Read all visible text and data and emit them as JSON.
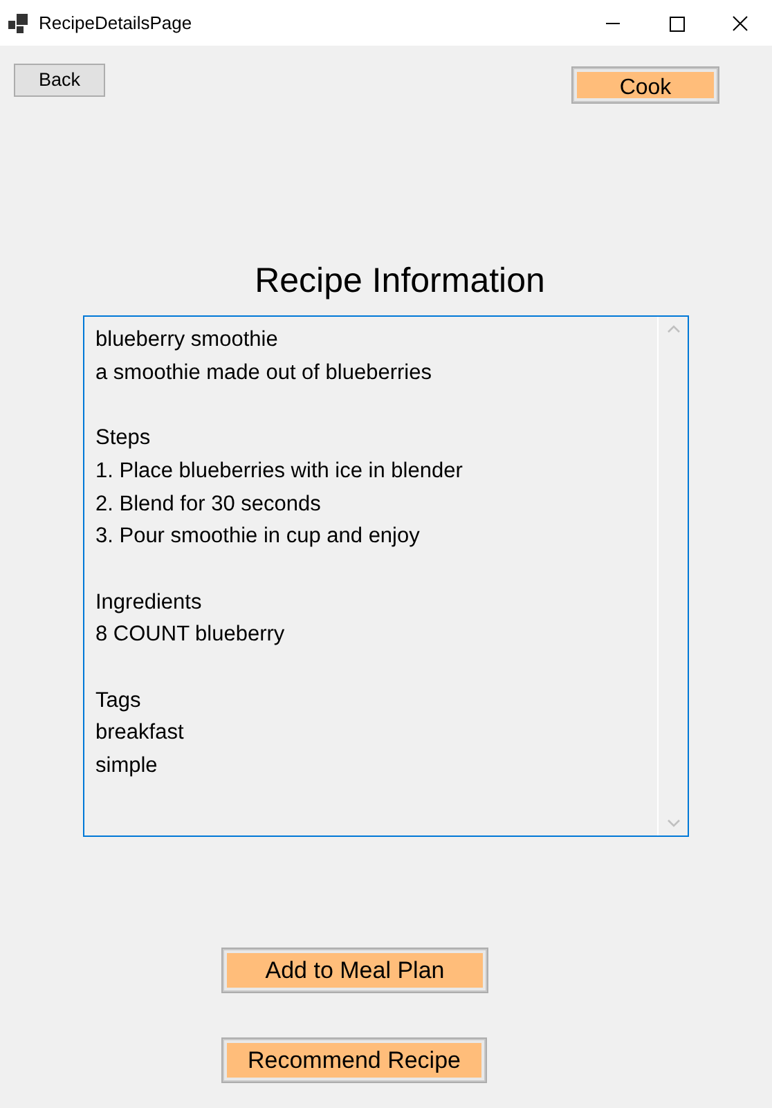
{
  "window": {
    "title": "RecipeDetailsPage"
  },
  "top_buttons": [
    "Back",
    "Cook"
  ],
  "heading": "Recipe Information",
  "recipe_text": [
    {
      "lines": [
        "blueberry smoothie",
        "a smoothie made out of blueberries"
      ]
    },
    {
      "lines": [
        "Steps",
        "1. Place blueberries with ice in blender",
        "2. Blend for 30 seconds",
        "3. Pour smoothie in cup and enjoy"
      ]
    },
    {
      "lines": [
        "Ingredients",
        "8 COUNT blueberry"
      ]
    },
    {
      "lines": [
        "Tags",
        "breakfast",
        "simple"
      ]
    }
  ],
  "bottom_buttons": [
    "Add to Meal Plan",
    "Recommend Recipe"
  ]
}
